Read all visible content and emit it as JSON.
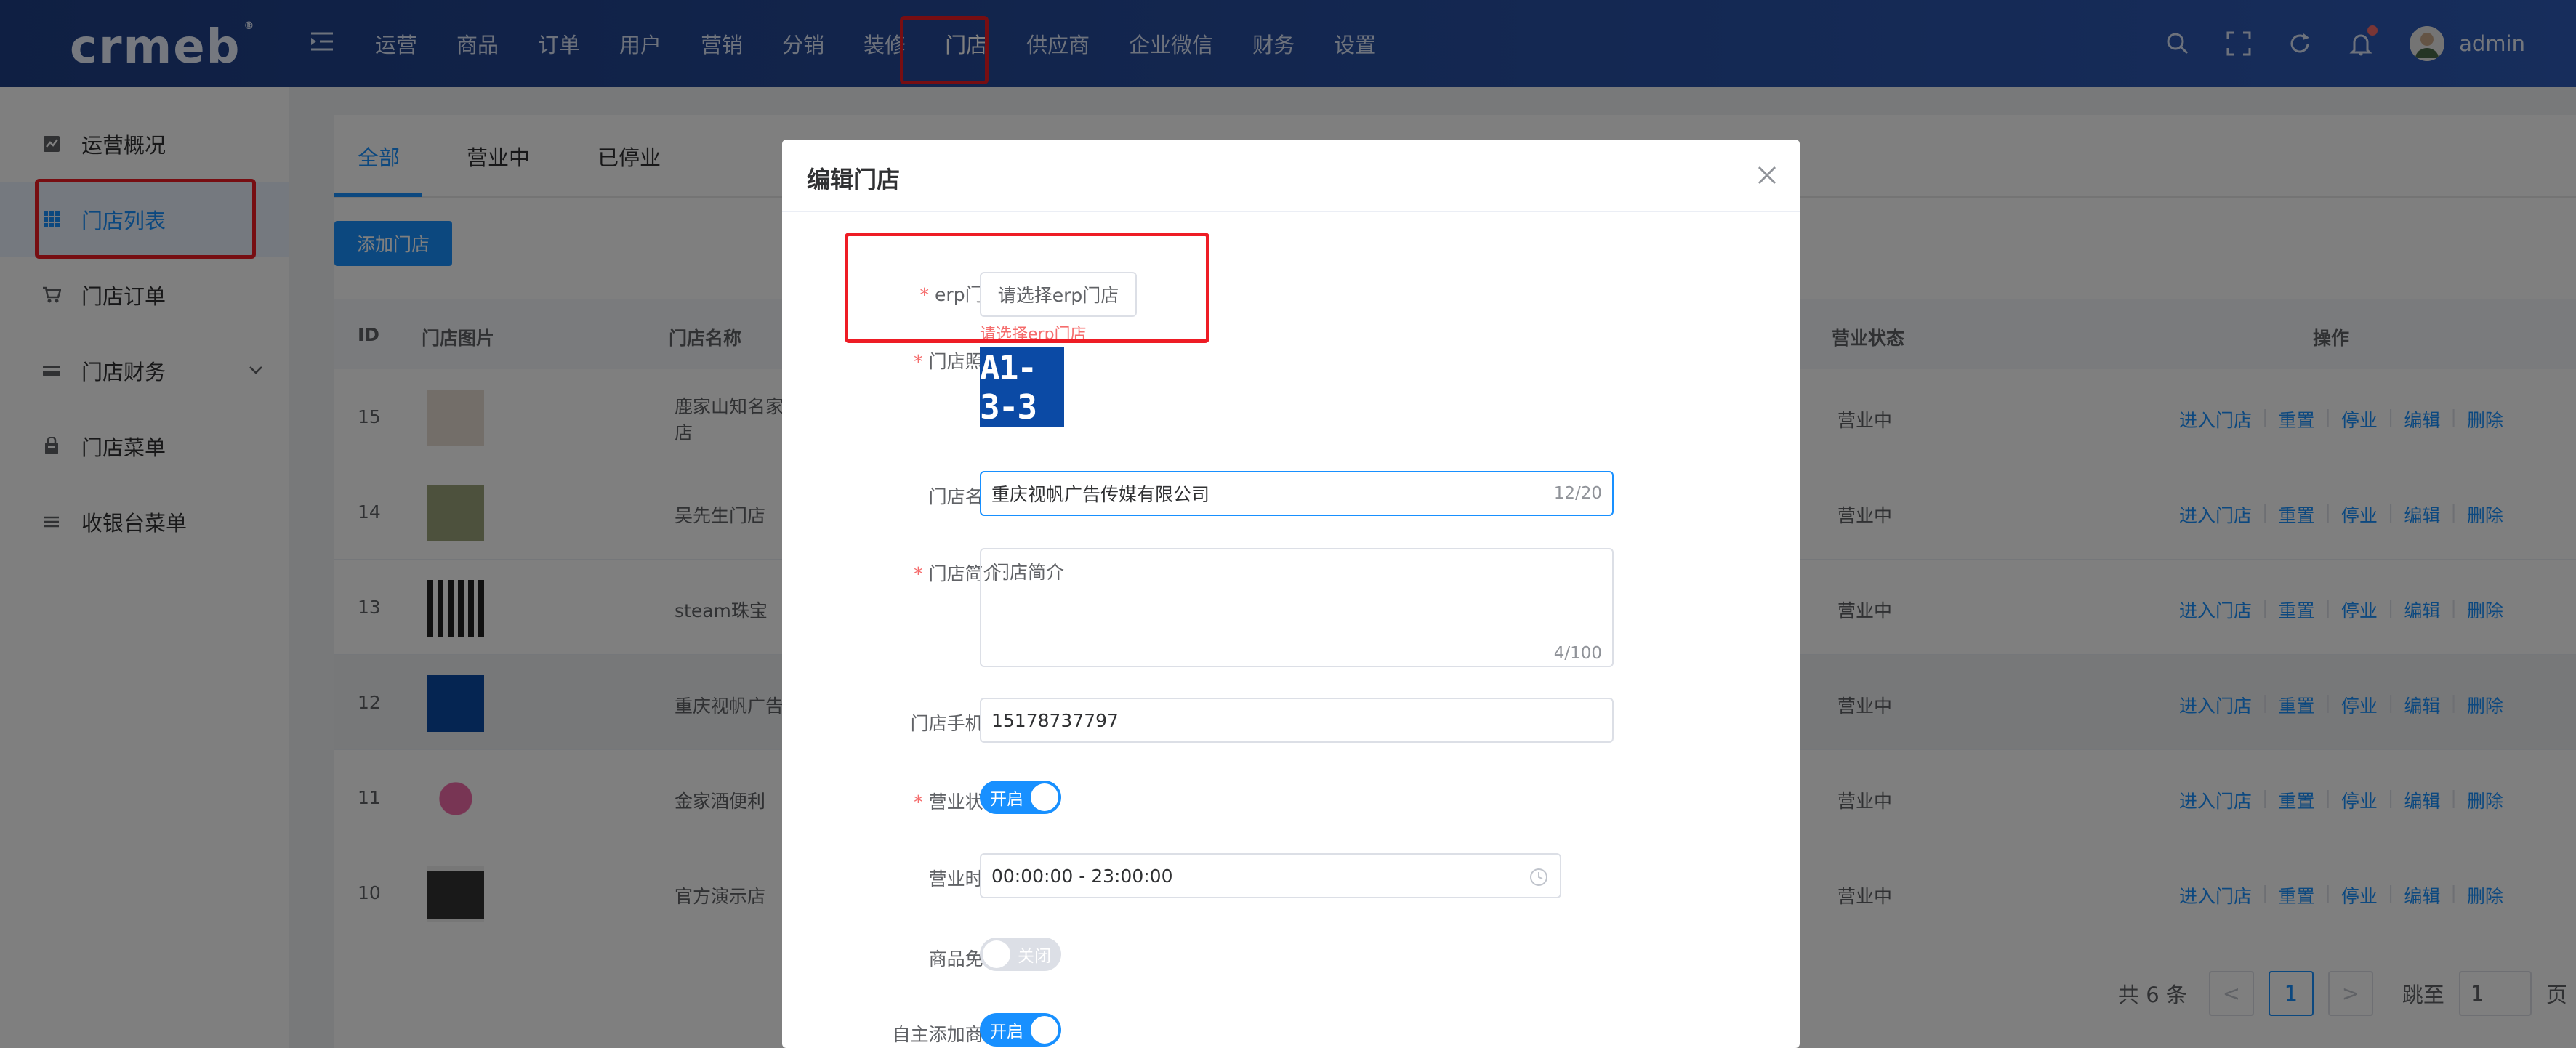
{
  "header": {
    "logo": "crmeb",
    "logo_mark": "®",
    "nav": [
      "运营",
      "商品",
      "订单",
      "用户",
      "营销",
      "分销",
      "装修",
      "门店",
      "供应商",
      "企业微信",
      "财务",
      "设置"
    ],
    "active_nav": "门店",
    "username": "admin"
  },
  "sidebar": {
    "items": [
      {
        "label": "运营概况",
        "icon": "chart-icon"
      },
      {
        "label": "门店列表",
        "icon": "grid-icon"
      },
      {
        "label": "门店订单",
        "icon": "cart-icon"
      },
      {
        "label": "门店财务",
        "icon": "finance-icon"
      },
      {
        "label": "门店菜单",
        "icon": "menu-book-icon"
      },
      {
        "label": "收银台菜单",
        "icon": "list-icon"
      }
    ],
    "active": "门店列表"
  },
  "main": {
    "tabs": [
      "全部",
      "营业中",
      "已停业"
    ],
    "add_button": "添加门店",
    "columns": {
      "id": "ID",
      "image": "门店图片",
      "name": "门店名称",
      "status": "营业状态",
      "ops": "操作"
    },
    "rows": [
      {
        "id": "15",
        "name": "鹿家山知名家",
        "name2": "店",
        "status": "营业中"
      },
      {
        "id": "14",
        "name": "吴先生门店",
        "name2": "",
        "status": "营业中"
      },
      {
        "id": "13",
        "name": "steam珠宝",
        "name2": "",
        "status": "营业中"
      },
      {
        "id": "12",
        "name": "重庆视帆广告",
        "name2": "",
        "status": "营业中"
      },
      {
        "id": "11",
        "name": "金家酒便利",
        "name2": "",
        "status": "营业中"
      },
      {
        "id": "10",
        "name": "官方演示店",
        "name2": "",
        "status": "营业中"
      }
    ],
    "ops": [
      "进入门店",
      "重置",
      "停业",
      "编辑",
      "删除"
    ],
    "pager": {
      "total": "共 6 条",
      "current": "1",
      "jump_label": "跳至",
      "jump_value": "1",
      "page_suffix": "页",
      "prev": "<",
      "next": ">"
    }
  },
  "dialog": {
    "title": "编辑门店",
    "erp_label": "erp门店:",
    "erp_button": "请选择erp门店",
    "erp_error": "请选择erp门店",
    "photo_label": "门店照片:",
    "photo_text": "A1-3-3",
    "name_label": "门店名称:",
    "name_value": "重庆视帆广告传媒有限公司",
    "name_count": "12/20",
    "intro_label": "门店简介:",
    "intro_value": "门店简介",
    "intro_count": "4/100",
    "phone_label": "门店手机号:",
    "phone_value": "15178737797",
    "status_label": "营业状态:",
    "status_switch": "开启",
    "hours_label": "营业时间:",
    "hours_value": "00:00:00 - 23:00:00",
    "audit_label": "商品免审:",
    "audit_switch": "关闭",
    "add_goods_label": "自主添加商品:",
    "add_goods_switch": "开启"
  }
}
